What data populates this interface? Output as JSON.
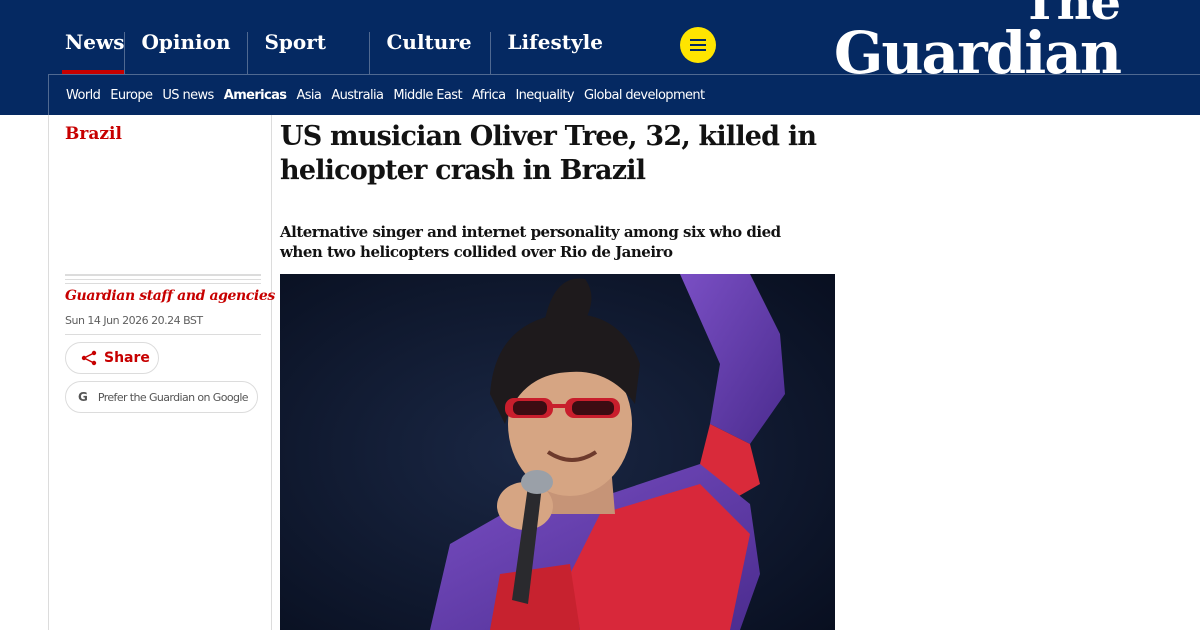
{
  "header": {
    "pillars": [
      "News",
      "Opinion",
      "Sport",
      "Culture",
      "Lifestyle"
    ],
    "active_pillar": "News",
    "menu_icon": "hamburger-menu-icon",
    "logo_line1": "The",
    "logo_line2": "Guardian",
    "subnav": [
      "World",
      "Europe",
      "US news",
      "Americas",
      "Asia",
      "Australia",
      "Middle East",
      "Africa",
      "Inequality",
      "Global development"
    ],
    "active_subnav": "Americas"
  },
  "article": {
    "section": "Brazil",
    "headline": "US musician Oliver Tree, 32, killed in helicopter crash in Brazil",
    "standfirst": "Alternative singer and internet personality among six who died when two helicopters collided over Rio de Janeiro",
    "byline": "Guardian staff and agencies",
    "dateline": "Sun 14 Jun 2026 20.24 BST",
    "share_label": "Share",
    "prefer_label": "Prefer the Guardian on Google",
    "prefer_icon_glyph": "G"
  },
  "colors": {
    "brand_blue": "#052962",
    "news_red": "#c70000",
    "menu_yellow": "#ffe500"
  }
}
